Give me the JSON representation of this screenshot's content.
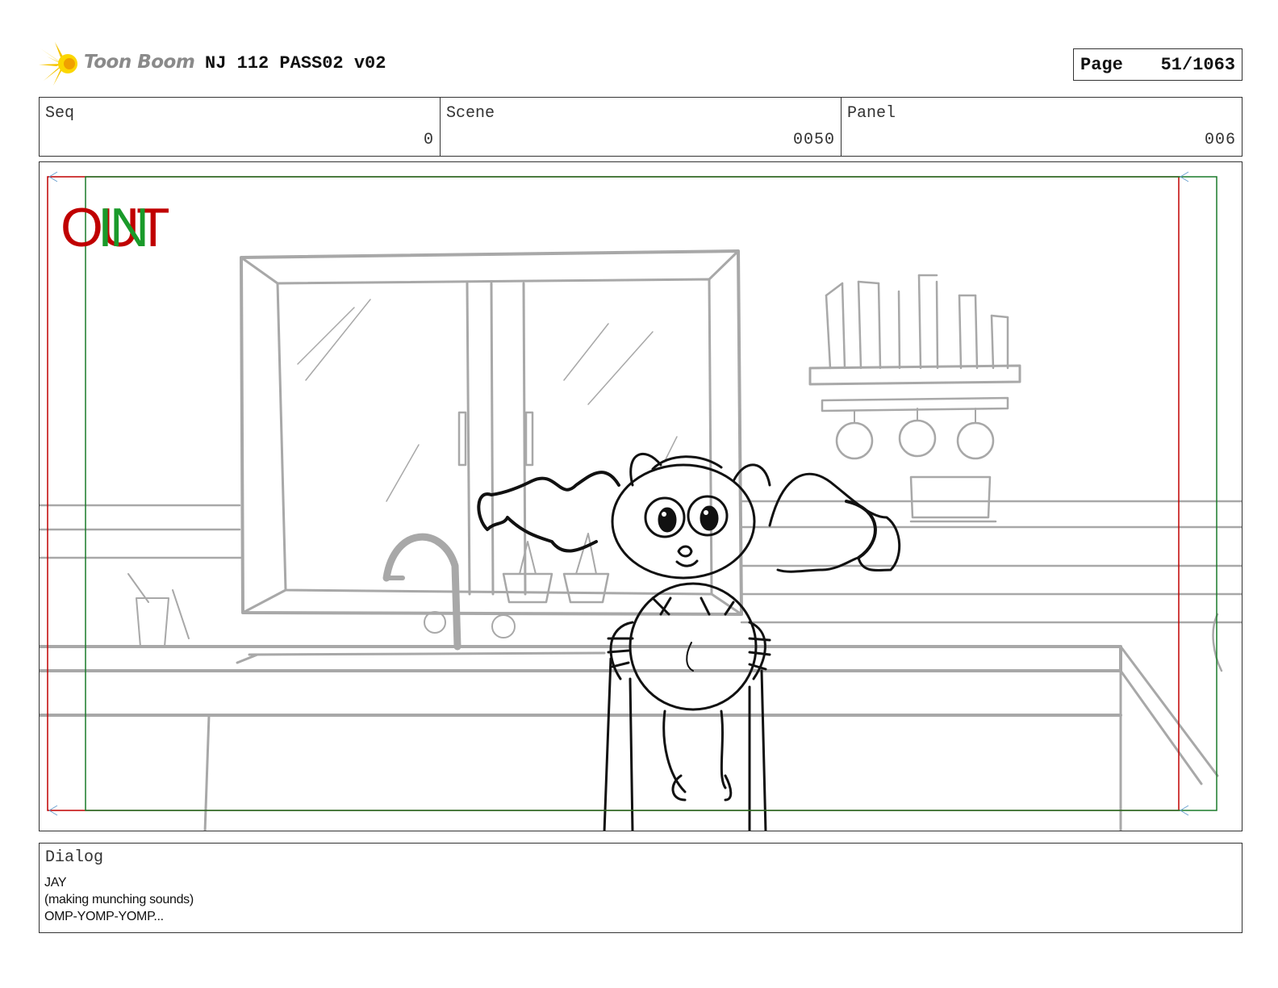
{
  "header": {
    "brand": "Toon Boom",
    "title": "NJ 112 PASS02 v02",
    "page_label": "Page",
    "page_number": "51/1063"
  },
  "info": {
    "seq": {
      "label": "Seq",
      "value": "0"
    },
    "scene": {
      "label": "Scene",
      "value": "0050"
    },
    "panel": {
      "label": "Panel",
      "value": "006"
    }
  },
  "frame": {
    "out_label": "OUT",
    "in_label": "IN",
    "out_color": "#c00000",
    "in_color": "#1a9a2a"
  },
  "dialog": {
    "label": "Dialog",
    "lines": [
      "JAY",
      "(making munching sounds)",
      "OMP-YOMP-YOMP..."
    ]
  }
}
